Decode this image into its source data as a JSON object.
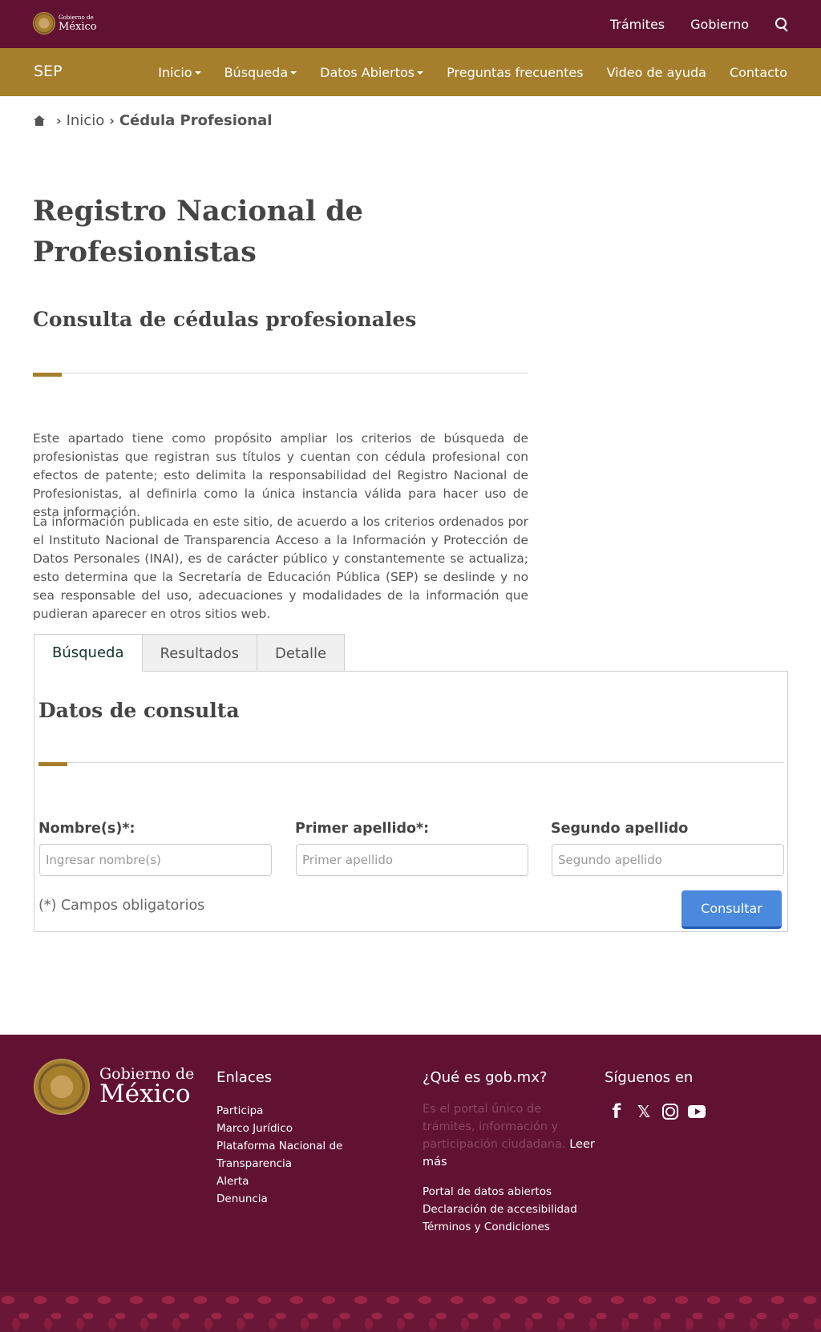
{
  "header": {
    "logo_line1": "Gobierno de",
    "logo_line2": "México",
    "links": [
      "Trámites",
      "Gobierno"
    ]
  },
  "subnav": {
    "brand": "SEP",
    "items": [
      {
        "label": "Inicio",
        "dropdown": true
      },
      {
        "label": "Búsqueda",
        "dropdown": true
      },
      {
        "label": "Datos Abiertos",
        "dropdown": true
      },
      {
        "label": "Preguntas frecuentes",
        "dropdown": false
      },
      {
        "label": "Video de ayuda",
        "dropdown": false
      },
      {
        "label": "Contacto",
        "dropdown": false
      }
    ]
  },
  "breadcrumb": {
    "items": [
      "Inicio"
    ],
    "current": "Cédula Profesional"
  },
  "main": {
    "title": "Registro Nacional de Profesionistas",
    "subtitle": "Consulta de cédulas profesionales",
    "paragraph1": "Este apartado tiene como propósito ampliar los criterios de búsqueda de profesionistas que registran sus títulos y cuentan con cédula profesional con efectos de patente; esto delimita la responsabilidad del Registro Nacional de Profesionistas, al definirla como la única instancia válida para hacer uso de esta información.",
    "paragraph2": "La información publicada en este sitio, de acuerdo a los criterios ordenados por el Instituto Nacional de Transparencia  Acceso a la Información y Protección de Datos Personales (INAI), es de carácter público y constantemente se actualiza; esto determina que la Secretaría de Educación Pública (SEP) se deslinde y no sea responsable del uso, adecuaciones y modalidades de la información que pudieran aparecer en otros sitios web."
  },
  "tabs": [
    {
      "label": "Búsqueda",
      "active": true
    },
    {
      "label": "Resultados",
      "active": false
    },
    {
      "label": "Detalle",
      "active": false
    }
  ],
  "form": {
    "title": "Datos de consulta",
    "fields": [
      {
        "label": "Nombre(s)*:",
        "placeholder": "Ingresar nombre(s)",
        "value": ""
      },
      {
        "label": "Primer apellido*:",
        "placeholder": "Primer apellido",
        "value": ""
      },
      {
        "label": "Segundo apellido",
        "placeholder": "Segundo apellido",
        "value": ""
      }
    ],
    "required_note": "(*) Campos obligatorios",
    "submit_label": "Consultar"
  },
  "footer": {
    "logo_line1": "Gobierno de",
    "logo_line2": "México",
    "links_title": "Enlaces",
    "links": [
      "Participa",
      "Marco Jurídico",
      "Plataforma Nacional de Transparencia",
      "Alerta",
      "Denuncia"
    ],
    "what_title": "¿Qué es gob.mx?",
    "what_text": "Es el portal único de trámites, información y participación ciudadana.",
    "what_more": "Leer más",
    "extra_links": [
      "Portal de datos abiertos",
      "Declaración de accesibilidad",
      "Términos y Condiciones"
    ],
    "social_title": "Síguenos en",
    "social": [
      "facebook-icon",
      "x-icon",
      "instagram-icon",
      "youtube-icon"
    ]
  },
  "colors": {
    "header_bg": "#611232",
    "subnav_bg": "#a57f2c",
    "button_bg": "#4a89dc",
    "footer_bg": "#611232"
  }
}
